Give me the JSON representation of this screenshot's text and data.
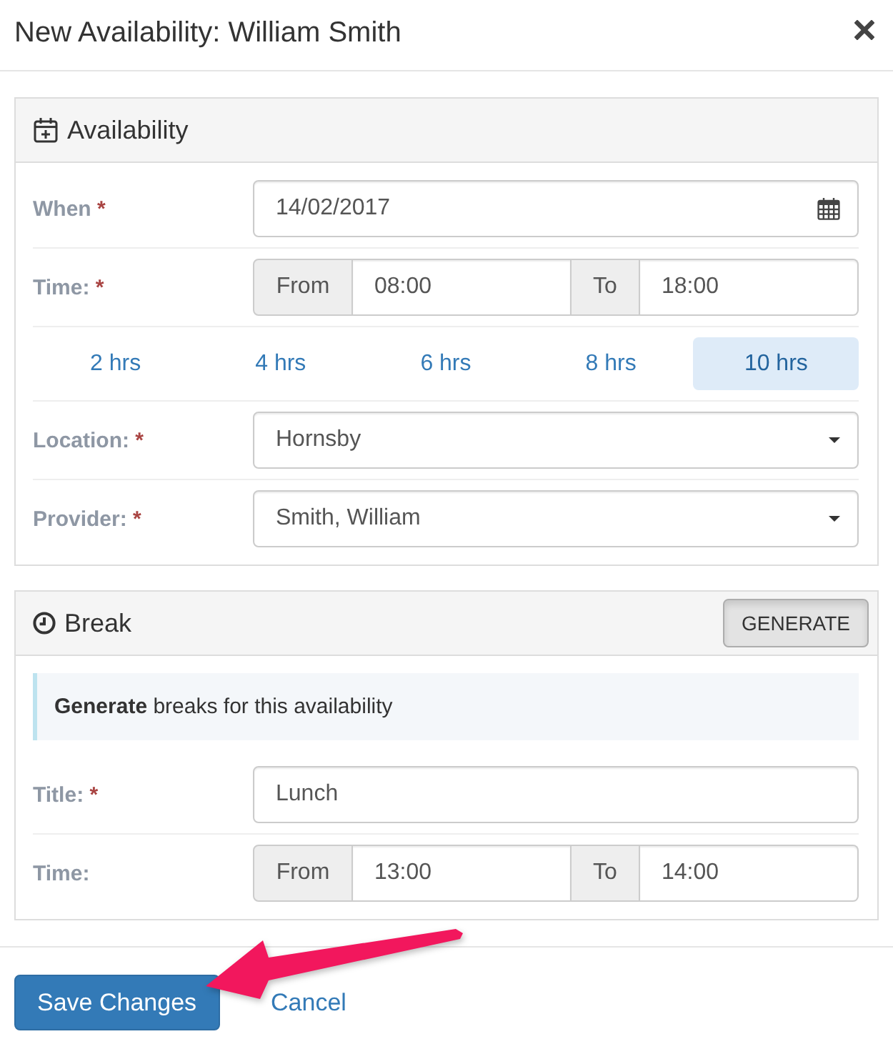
{
  "modal": {
    "title": "New Availability: William Smith"
  },
  "availability_panel": {
    "heading": "Availability",
    "rows": [
      {
        "kind": "date",
        "label": "When",
        "required_mark": "*",
        "value": "14/02/2017"
      },
      {
        "kind": "time_range",
        "label": "Time:",
        "required_mark": "*",
        "from_label": "From",
        "from_value": "08:00",
        "to_label": "To",
        "to_value": "18:00"
      },
      {
        "kind": "durations",
        "options": [
          {
            "label": "2 hrs",
            "selected": false
          },
          {
            "label": "4 hrs",
            "selected": false
          },
          {
            "label": "6 hrs",
            "selected": false
          },
          {
            "label": "8 hrs",
            "selected": false
          },
          {
            "label": "10 hrs",
            "selected": true
          }
        ]
      },
      {
        "kind": "select",
        "label": "Location:",
        "required_mark": "*",
        "value": "Hornsby"
      },
      {
        "kind": "select",
        "label": "Provider:",
        "required_mark": "*",
        "value": "Smith, William"
      }
    ]
  },
  "break_panel": {
    "heading": "Break",
    "button": "GENERATE",
    "note": "**Generate** breaks for this availability",
    "rows": [
      {
        "kind": "text",
        "label": "Title:",
        "required_mark": "*",
        "value": "Lunch"
      },
      {
        "kind": "time_range",
        "label": "Time:",
        "from_label": "From",
        "from_value": "13:00",
        "to_label": "To",
        "to_value": "14:00"
      }
    ]
  },
  "footer": {
    "save_button": "Save Changes",
    "cancel_link": "Cancel"
  }
}
